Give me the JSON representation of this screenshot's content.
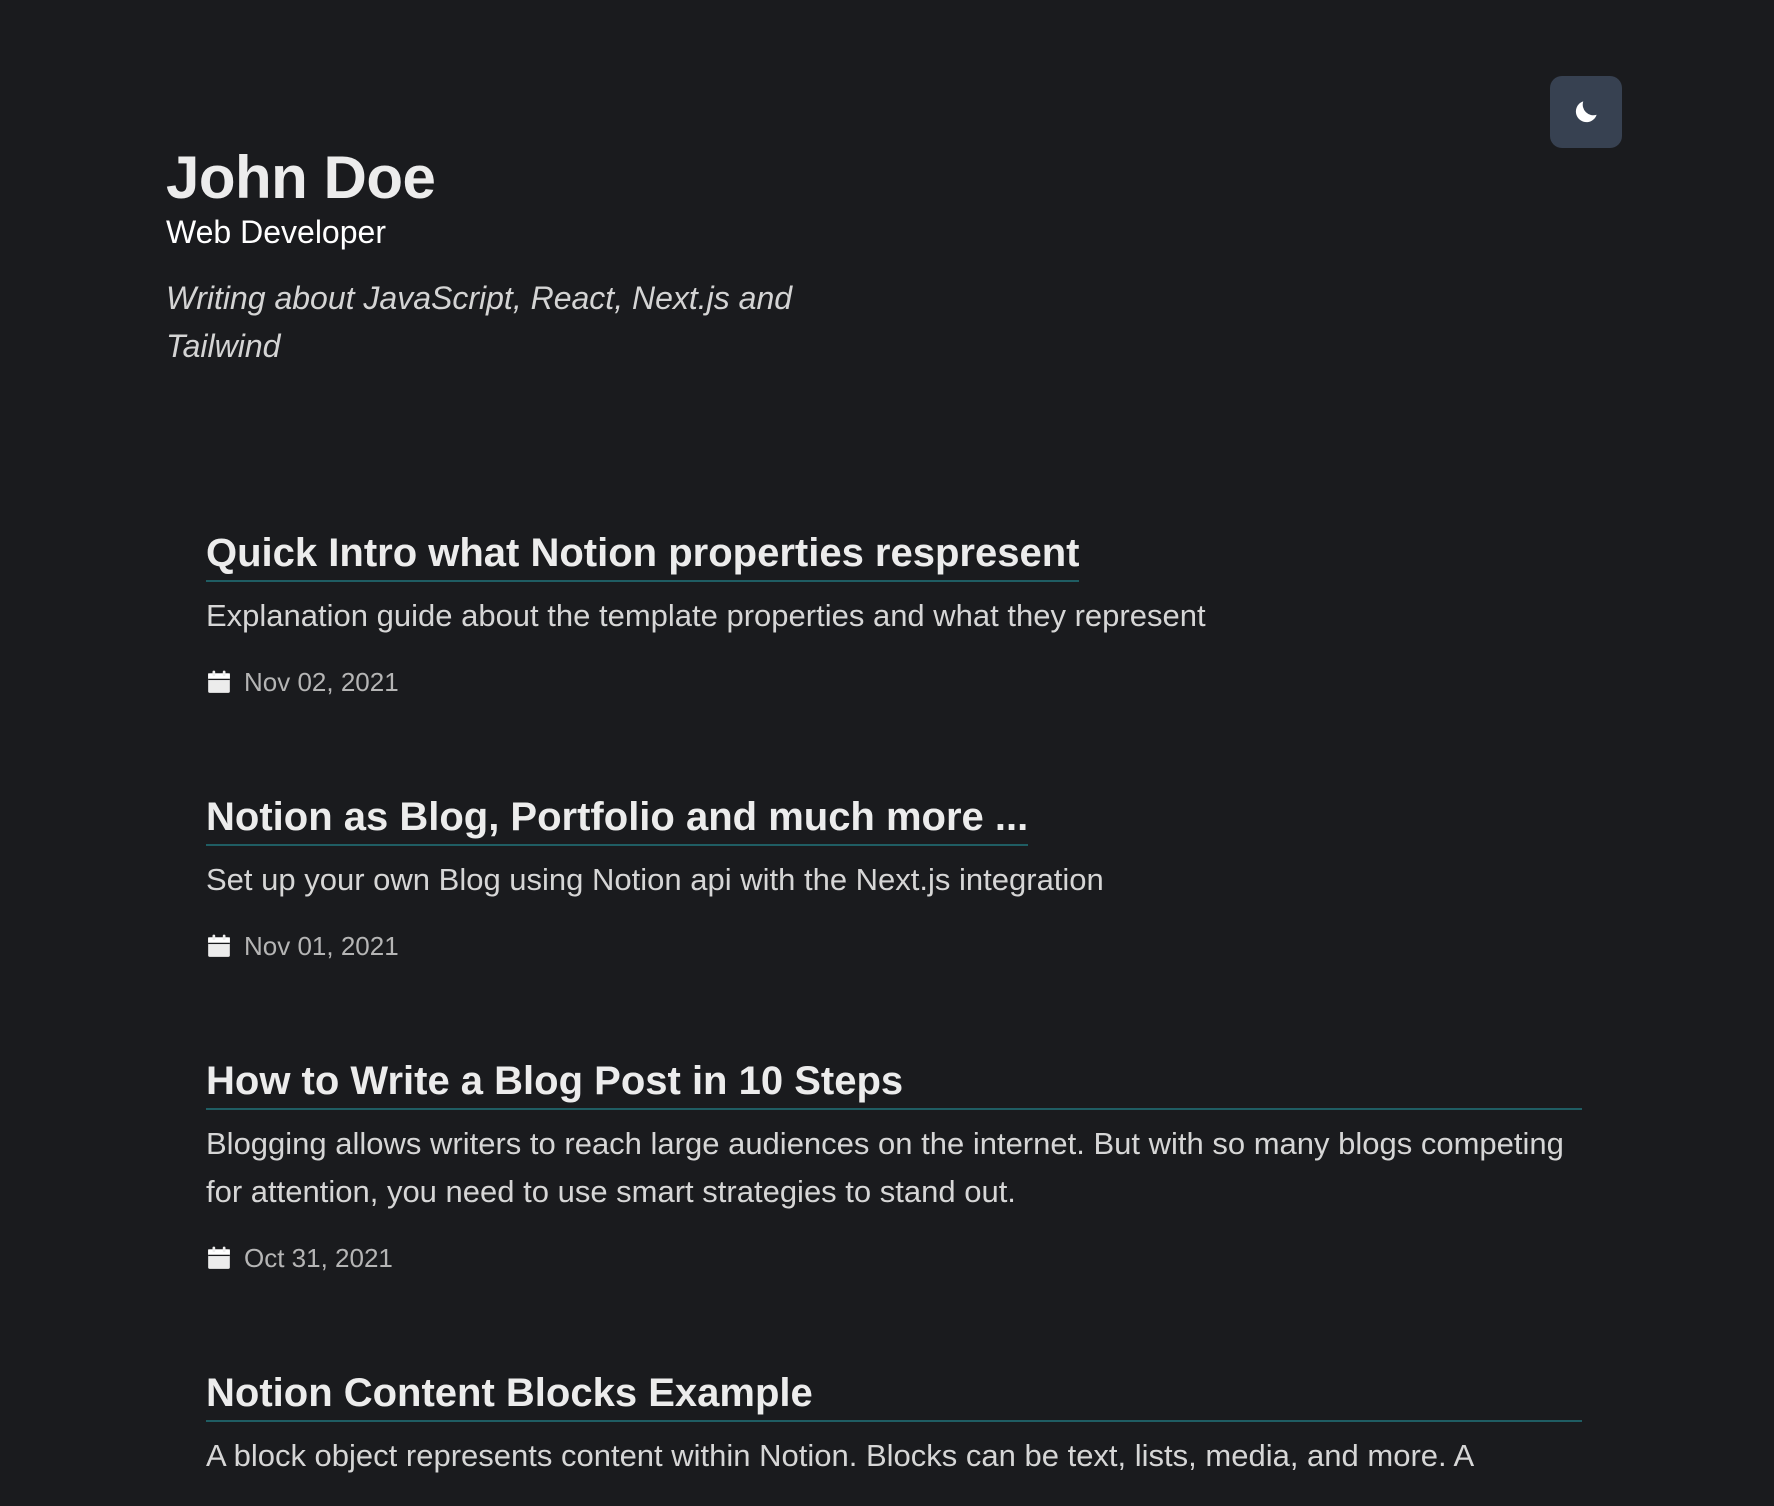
{
  "header": {
    "name": "John Doe",
    "role": "Web Developer",
    "tagline": "Writing about JavaScript, React, Next.js and Tailwind"
  },
  "theme_toggle": {
    "icon": "moon-icon",
    "background": "#374151"
  },
  "colors": {
    "background": "#1a1b1e",
    "title_underline": "#1f5d63",
    "text": "#ececec",
    "muted": "#b5b5b5"
  },
  "posts": [
    {
      "title": "Quick Intro what Notion properties respresent",
      "description": "Explanation guide about the template properties and what they represent",
      "date": "Nov 02, 2021"
    },
    {
      "title": "Notion as Blog, Portfolio and much more ...",
      "description": "Set up your own Blog using Notion api with the Next.js integration",
      "date": "Nov 01, 2021"
    },
    {
      "title": "How to Write a Blog Post in 10 Steps",
      "description": "Blogging allows writers to reach large audiences on the internet. But with so many blogs competing for attention, you need to use smart strategies to stand out.",
      "date": "Oct 31, 2021"
    },
    {
      "title": "Notion Content Blocks Example",
      "description": "A block object represents content within Notion. Blocks can be text, lists, media, and more. A",
      "date": ""
    }
  ]
}
